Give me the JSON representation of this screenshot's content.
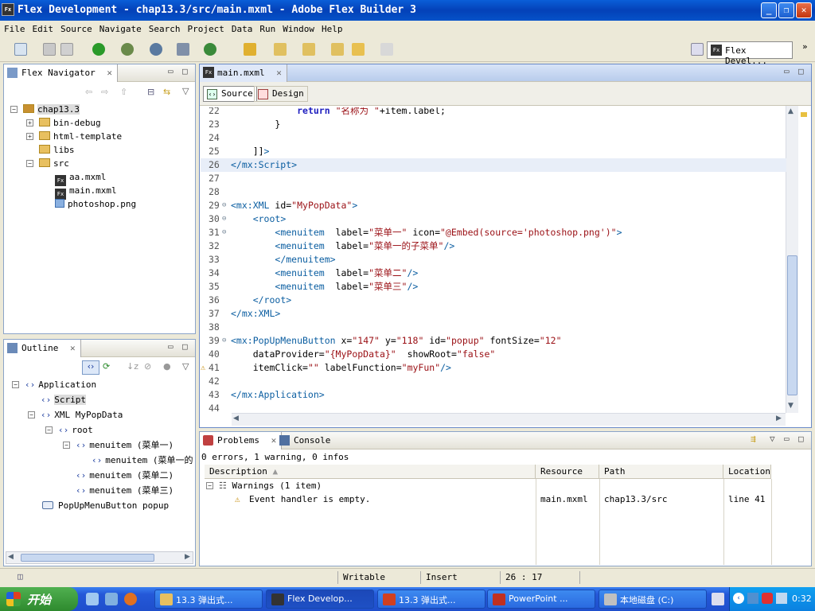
{
  "window": {
    "title": "Flex Development - chap13.3/src/main.mxml - Adobe Flex Builder 3",
    "icon": "Fx"
  },
  "menu": [
    "File",
    "Edit",
    "Source",
    "Navigate",
    "Search",
    "Project",
    "Data",
    "Run",
    "Window",
    "Help"
  ],
  "perspective": {
    "label": "Flex Devel..."
  },
  "navigator": {
    "tab": "Flex Navigator",
    "items": [
      {
        "label": "chap13.3",
        "kind": "project"
      },
      {
        "label": "bin-debug",
        "kind": "folder"
      },
      {
        "label": "html-template",
        "kind": "folder"
      },
      {
        "label": "libs",
        "kind": "folder"
      },
      {
        "label": "src",
        "kind": "folder"
      },
      {
        "label": "aa.mxml",
        "kind": "fx"
      },
      {
        "label": "main.mxml",
        "kind": "fx"
      },
      {
        "label": "photoshop.png",
        "kind": "image"
      }
    ]
  },
  "outline": {
    "tab": "Outline",
    "items": [
      {
        "label": "Application"
      },
      {
        "label": "Script"
      },
      {
        "label": "XML MyPopData"
      },
      {
        "label": "root"
      },
      {
        "label": "menuitem (菜单一)"
      },
      {
        "label": "menuitem (菜单一的"
      },
      {
        "label": "menuitem (菜单二)"
      },
      {
        "label": "menuitem (菜单三)"
      },
      {
        "label": "PopUpMenuButton popup"
      }
    ]
  },
  "editor": {
    "tab": "main.mxml",
    "source_label": "Source",
    "design_label": "Design",
    "lines": [
      {
        "n": "22",
        "text": "            return \"名称为 \"+item.label;"
      },
      {
        "n": "23",
        "text": "        }"
      },
      {
        "n": "24",
        "text": ""
      },
      {
        "n": "25",
        "text": "    ]]>"
      },
      {
        "n": "26",
        "text": "</mx:Script>"
      },
      {
        "n": "27",
        "text": ""
      },
      {
        "n": "28",
        "text": ""
      },
      {
        "n": "29",
        "text": "<mx:XML id=\"MyPopData\">"
      },
      {
        "n": "30",
        "text": "    <root>"
      },
      {
        "n": "31",
        "text": "        <menuitem  label=\"菜单一\" icon=\"@Embed(source='photoshop.png')\">"
      },
      {
        "n": "32",
        "text": "        <menuitem  label=\"菜单一的子菜单\"/>"
      },
      {
        "n": "33",
        "text": "        </menuitem>"
      },
      {
        "n": "34",
        "text": "        <menuitem  label=\"菜单二\"/>"
      },
      {
        "n": "35",
        "text": "        <menuitem  label=\"菜单三\"/>"
      },
      {
        "n": "36",
        "text": "    </root>"
      },
      {
        "n": "37",
        "text": "</mx:XML>"
      },
      {
        "n": "38",
        "text": ""
      },
      {
        "n": "39",
        "text": "<mx:PopUpMenuButton x=\"147\" y=\"118\" id=\"popup\" fontSize=\"12\""
      },
      {
        "n": "40",
        "text": "    dataProvider=\"{MyPopData}\"  showRoot=\"false\""
      },
      {
        "n": "41",
        "text": "    itemClick=\"\" labelFunction=\"myFun\"/>"
      },
      {
        "n": "42",
        "text": ""
      },
      {
        "n": "43",
        "text": "</mx:Application>"
      },
      {
        "n": "44",
        "text": ""
      }
    ]
  },
  "problems": {
    "tab": "Problems",
    "console_tab": "Console",
    "summary": "0 errors, 1 warning, 0 infos",
    "columns": [
      "Description",
      "Resource",
      "Path",
      "Location"
    ],
    "group": "Warnings (1 item)",
    "rows": [
      {
        "description": "Event handler is empty.",
        "resource": "main.mxml",
        "path": "chap13.3/src",
        "location": "line 41"
      }
    ]
  },
  "status": {
    "writable": "Writable",
    "insert": "Insert",
    "position": "26 : 17"
  },
  "taskbar": {
    "start": "开始",
    "buttons": [
      {
        "label": "13.3 弹出式..."
      },
      {
        "label": "Flex Develop..."
      },
      {
        "label": "13.3 弹出式..."
      },
      {
        "label": "PowerPoint ..."
      },
      {
        "label": "本地磁盘 (C:)"
      }
    ],
    "clock": "0:32"
  },
  "colors": {
    "accent": "#0a5ed8",
    "tag": "#0b5ea1",
    "string": "#9a0f14",
    "keyword": "#1f1fbf"
  }
}
